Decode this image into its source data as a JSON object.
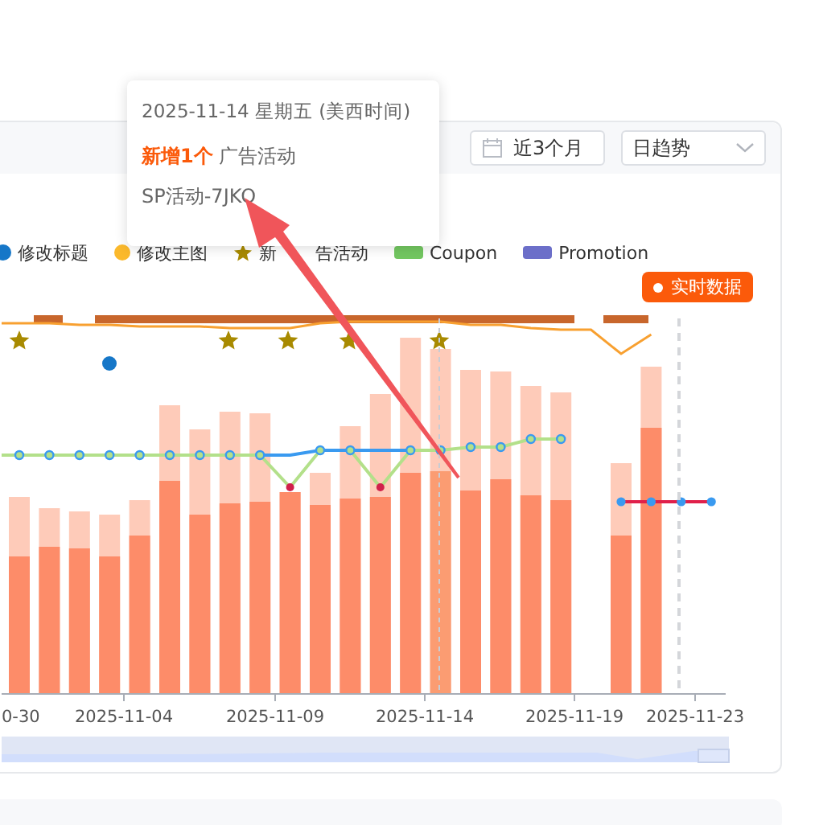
{
  "header": {
    "date_range": "近3个月",
    "granularity": "日趋势"
  },
  "tooltip": {
    "title": "2025-11-14 星期五 (美西时间)",
    "line": "**新增1个** 广告活动",
    "detail": "SP活动-7JKO"
  },
  "legend": [
    {
      "label": "修改标题",
      "kind": "dot",
      "color": "#1677c8"
    },
    {
      "label": "修改主图",
      "kind": "dot",
      "color": "#fbb92c"
    },
    {
      "label": "新",
      "label_after_cover": "告活动",
      "kind": "star",
      "color": "#a88a00"
    },
    {
      "label": "Coupon",
      "kind": "bar",
      "color": "#73c761"
    },
    {
      "label": "Promotion",
      "kind": "bar",
      "color": "#6c6fc9"
    }
  ],
  "realtime_badge": "实时数据",
  "chart": {
    "zoom_slider": {
      "level": 1
    },
    "x_labels": [
      "0-30",
      "2025-11-04",
      "2025-11-09",
      "2025-11-14",
      "2025-11-19",
      "2025-11-23"
    ]
  }
}
